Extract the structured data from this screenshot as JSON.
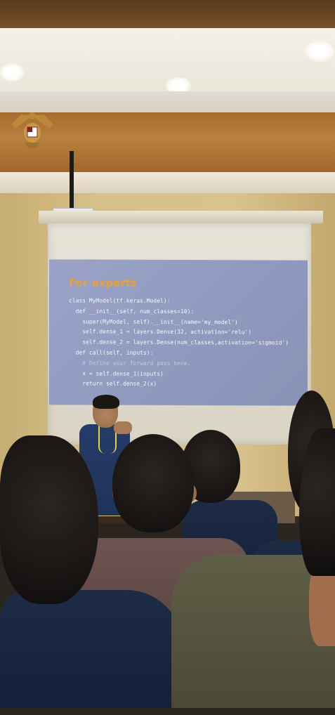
{
  "slide": {
    "title": "For experts",
    "code_lines": [
      "class MyModel(tf.keras.Model):",
      "  def __init__(self, num_classes=10):",
      "    super(MyModel, self).__init__(name='my_model')",
      "    self.dense_1 = layers.Dense(32, activation='relu')",
      "    self.dense_2 = layers.Dense(num_classes,activation='sigmoid')",
      "",
      "  def call(self, inputs):",
      "    # Define your forward pass here.",
      "    x = self.dense_1(inputs)",
      "    return self.dense_2(x)"
    ]
  },
  "colors": {
    "slide_bg": "#8f99bd",
    "title": "#e9a23b",
    "wall": "#d7c08a",
    "ceiling_wood": "#a66b2e"
  }
}
